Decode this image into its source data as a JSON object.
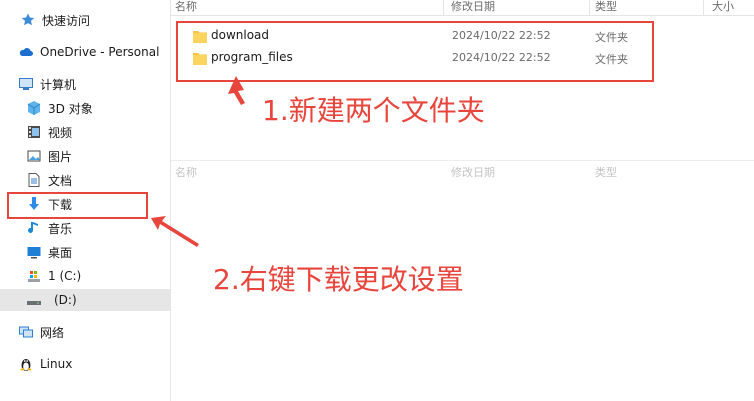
{
  "nav": {
    "items": [
      {
        "label": "快速访问",
        "icon": "star-icon"
      },
      {
        "label": "OneDrive - Personal",
        "icon": "cloud-icon"
      },
      {
        "label": "计算机",
        "icon": "computer-icon"
      },
      {
        "label": "3D 对象",
        "icon": "cube-icon"
      },
      {
        "label": "视频",
        "icon": "video-icon"
      },
      {
        "label": "图片",
        "icon": "picture-icon"
      },
      {
        "label": "文档",
        "icon": "document-icon"
      },
      {
        "label": "下载",
        "icon": "download-icon"
      },
      {
        "label": "音乐",
        "icon": "music-icon"
      },
      {
        "label": "桌面",
        "icon": "desktop-icon"
      },
      {
        "label": "1 (C:)",
        "icon": "drive-icon"
      },
      {
        "label": "(D:)",
        "icon": "drive-icon"
      },
      {
        "label": "网络",
        "icon": "network-icon"
      },
      {
        "label": "Linux",
        "icon": "linux-icon"
      }
    ]
  },
  "columns": {
    "name": "名称",
    "modified": "修改日期",
    "type": "类型",
    "size": "大小"
  },
  "files": [
    {
      "name": "download",
      "modified": "2024/10/22 22:52",
      "type": "文件夹"
    },
    {
      "name": "program_files",
      "modified": "2024/10/22 22:52",
      "type": "文件夹"
    }
  ],
  "annotations": {
    "step1": "1.新建两个文件夹",
    "step2": "2.右键下载更改设置"
  },
  "colors": {
    "accent": "#e8453c",
    "folder": "#f6c344",
    "selected_bg": "#e6e6e6"
  }
}
